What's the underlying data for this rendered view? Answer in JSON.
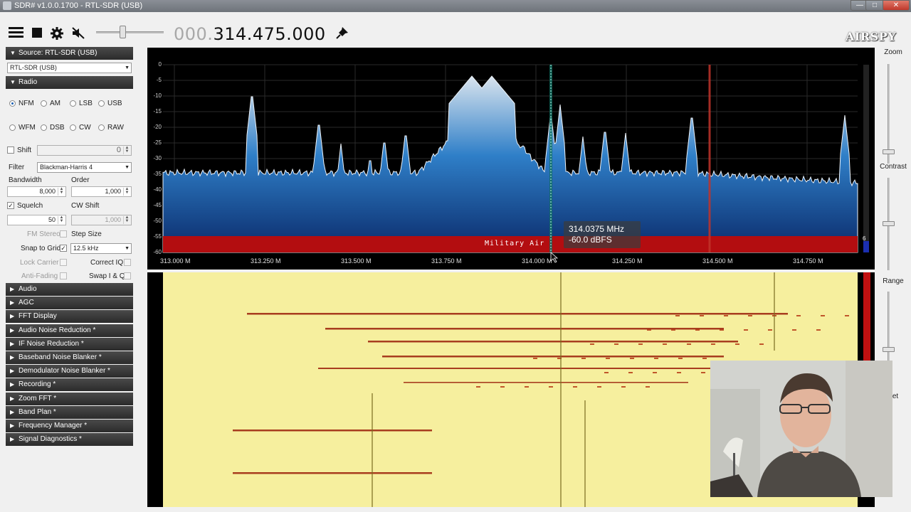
{
  "window": {
    "title": "SDR# v1.0.0.1700 - RTL-SDR (USB)",
    "min": "—",
    "max": "□",
    "close": "✕"
  },
  "toolbar": {
    "freq_dim": "000.",
    "freq_main": "314.475.000",
    "logo": "AIRSPY",
    "icons": [
      "menu-icon",
      "stop-icon",
      "gear-icon",
      "mute-speaker-icon",
      "pin-icon"
    ]
  },
  "left": {
    "source_header": "Source: RTL-SDR (USB)",
    "source_device": "RTL-SDR (USB)",
    "radio_header": "Radio",
    "modes": [
      "NFM",
      "AM",
      "LSB",
      "USB",
      "WFM",
      "DSB",
      "CW",
      "RAW"
    ],
    "selected_mode": "NFM",
    "shift_label": "Shift",
    "shift_value": "0",
    "filter_label": "Filter",
    "filter_value": "Blackman-Harris 4",
    "bandwidth_label": "Bandwidth",
    "bandwidth_value": "8,000",
    "order_label": "Order",
    "order_value": "1,000",
    "squelch_label": "Squelch",
    "squelch_value": "50",
    "cw_shift_label": "CW Shift",
    "cw_shift_value": "1,000",
    "fm_stereo_label": "FM Stereo",
    "step_size_label": "Step Size",
    "snap_label": "Snap to Grid",
    "step_value": "12.5 kHz",
    "lock_carrier_label": "Lock Carrier",
    "correct_iq_label": "Correct IQ",
    "anti_fading_label": "Anti-Fading",
    "swap_iq_label": "Swap I & Q",
    "collapsed_sections": [
      "Audio",
      "AGC",
      "FFT Display",
      "Audio Noise Reduction *",
      "IF Noise Reduction *",
      "Baseband Noise Blanker *",
      "Demodulator Noise Blanker *",
      "Recording *",
      "Zoom FFT *",
      "Band Plan *",
      "Frequency Manager *",
      "Signal Diagnostics *"
    ]
  },
  "spectrum": {
    "y_ticks": [
      "0",
      "-5",
      "-10",
      "-15",
      "-20",
      "-25",
      "-30",
      "-35",
      "-40",
      "-45",
      "-50",
      "-55",
      "-60"
    ],
    "x_ticks": [
      "313.000 M",
      "313.250 M",
      "313.500 M",
      "313.750 M",
      "314.000 M",
      "314.250 M",
      "314.500 M",
      "314.750 M"
    ],
    "band_label": "Military Air",
    "tooltip_freq": "314.0375 MHz",
    "tooltip_level": "-60.0 dBFS",
    "scale_marker": "6"
  },
  "right": {
    "zoom_label": "Zoom",
    "contrast_label": "Contrast",
    "range_label": "Range",
    "offset_fragment": "et"
  },
  "colors": {
    "accent_blue": "#1f6ec6",
    "band_red": "#b30d10",
    "waterfall_bg": "#f6ef9e"
  }
}
